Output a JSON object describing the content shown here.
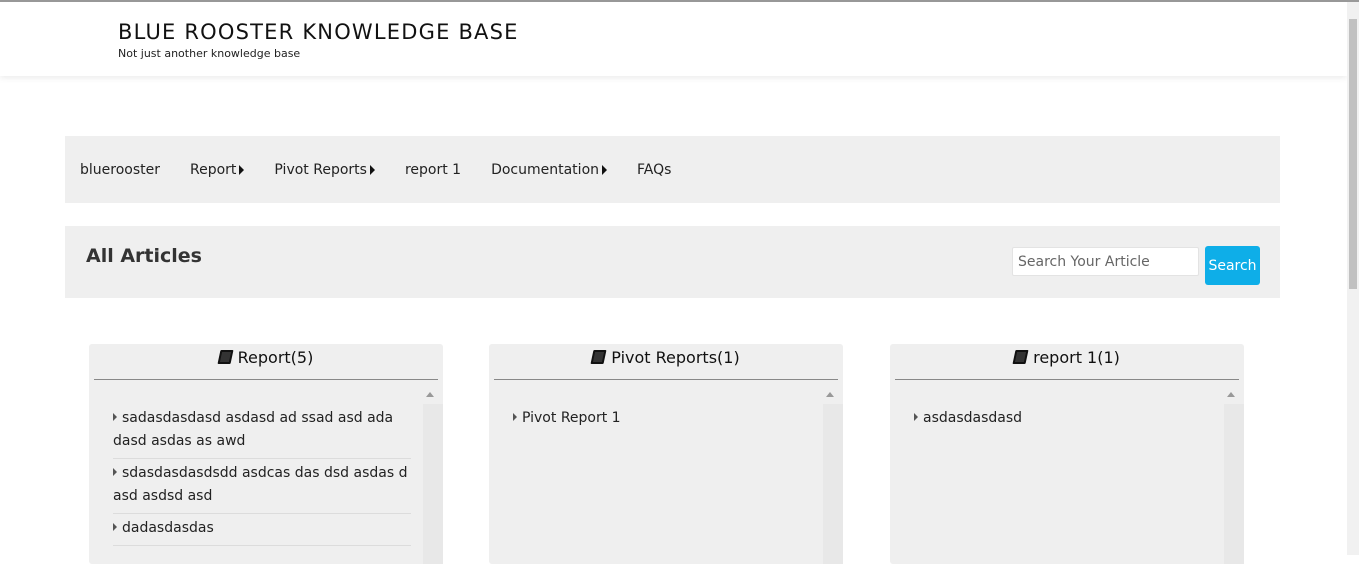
{
  "header": {
    "title": "BLUE ROOSTER KNOWLEDGE BASE",
    "tagline": "Not just another knowledge base"
  },
  "nav": {
    "items": [
      {
        "label": "bluerooster",
        "has_submenu": false
      },
      {
        "label": "Report",
        "has_submenu": true
      },
      {
        "label": "Pivot Reports",
        "has_submenu": true
      },
      {
        "label": "report 1",
        "has_submenu": false
      },
      {
        "label": "Documentation",
        "has_submenu": true
      },
      {
        "label": "FAQs",
        "has_submenu": false
      }
    ]
  },
  "articles": {
    "heading": "All Articles",
    "search_placeholder": "Search Your Article",
    "search_button": "Search"
  },
  "categories": [
    {
      "title": "Report(5)",
      "articles": [
        "sadasdasdasd asdasd ad ssad asd ada dasd asdas as awd",
        "sdasdasdasdsdd asdcas das dsd asdas d asd asdsd asd",
        "dadasdasdas"
      ]
    },
    {
      "title": "Pivot Reports(1)",
      "articles": [
        "Pivot Report 1"
      ]
    },
    {
      "title": "report 1(1)",
      "articles": [
        "asdasdasdasd"
      ]
    }
  ],
  "colors": {
    "accent": "#0eaee8",
    "panel": "#efefef"
  }
}
